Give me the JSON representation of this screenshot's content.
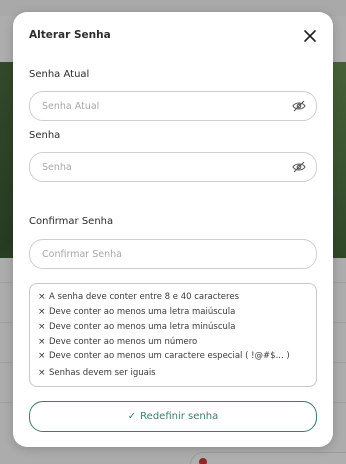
{
  "dialog": {
    "title": "Alterar Senha",
    "close_icon": "close-icon"
  },
  "fields": {
    "current_password": {
      "label": "Senha Atual",
      "placeholder": "Senha Atual",
      "value": ""
    },
    "new_password": {
      "label": "Senha",
      "placeholder": "Senha",
      "value": ""
    },
    "confirm_password": {
      "label": "Confirmar Senha",
      "placeholder": "Confirmar Senha",
      "value": ""
    },
    "visibility_icon": "eye-off-icon"
  },
  "rules": [
    {
      "icon": "×",
      "text": "A senha deve conter entre 8 e 40 caracteres"
    },
    {
      "icon": "×",
      "text": "Deve conter ao menos uma letra maiúscula"
    },
    {
      "icon": "×",
      "text": "Deve conter ao menos uma letra minúscula"
    },
    {
      "icon": "×",
      "text": "Deve conter ao menos um número"
    },
    {
      "icon": "×",
      "text": "Deve conter ao menos um caractere especial ( !@#$... )"
    },
    {
      "icon": "×",
      "text": "Senhas devem ser iguais"
    }
  ],
  "submit": {
    "icon": "✓",
    "label": "Redefinir senha"
  },
  "colors": {
    "accent": "#3f7a6c"
  }
}
